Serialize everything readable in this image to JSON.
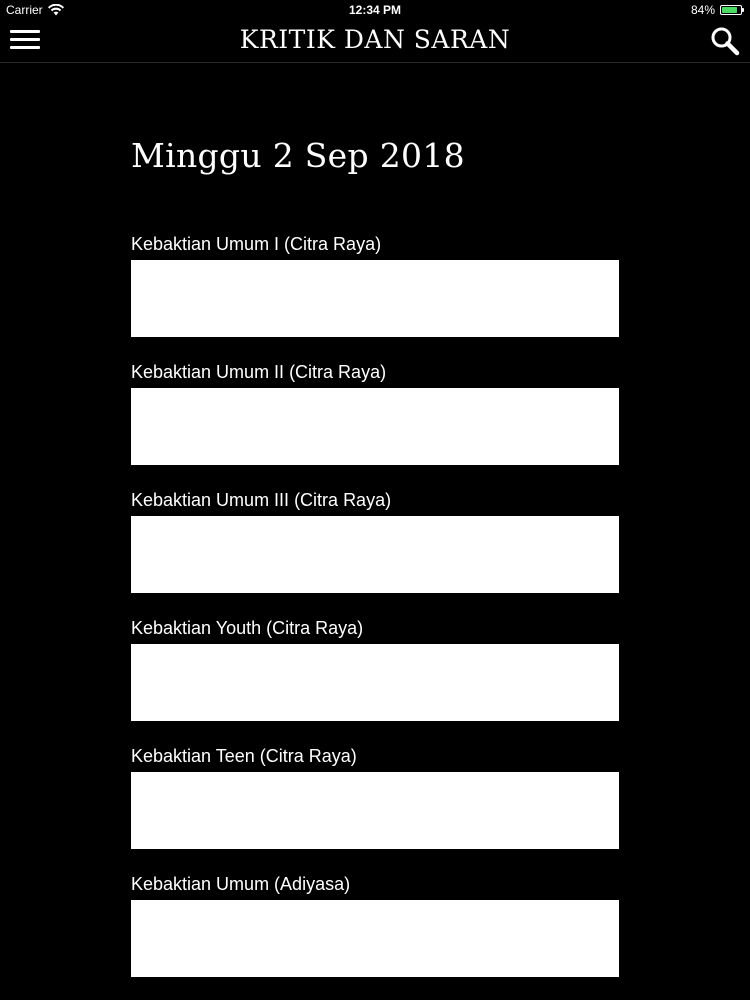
{
  "status_bar": {
    "carrier": "Carrier",
    "time": "12:34 PM",
    "battery": "84%",
    "battery_level": 0.84,
    "battery_color": "#4cd964",
    "wifi_icon": "wifi-icon"
  },
  "nav": {
    "title": "KRITIK DAN SARAN",
    "menu_icon": "hamburger-menu-icon",
    "search_icon": "search-icon"
  },
  "page": {
    "date": "Minggu 2 Sep 2018"
  },
  "fields": [
    {
      "label": "Kebaktian Umum I (Citra Raya)",
      "value": ""
    },
    {
      "label": "Kebaktian Umum II (Citra Raya)",
      "value": ""
    },
    {
      "label": "Kebaktian Umum III (Citra Raya)",
      "value": ""
    },
    {
      "label": "Kebaktian Youth (Citra Raya)",
      "value": ""
    },
    {
      "label": "Kebaktian Teen (Citra Raya)",
      "value": ""
    },
    {
      "label": "Kebaktian Umum (Adiyasa)",
      "value": ""
    }
  ],
  "colors": {
    "background": "#000000",
    "field_background": "#ffffff",
    "text": "#ffffff"
  }
}
